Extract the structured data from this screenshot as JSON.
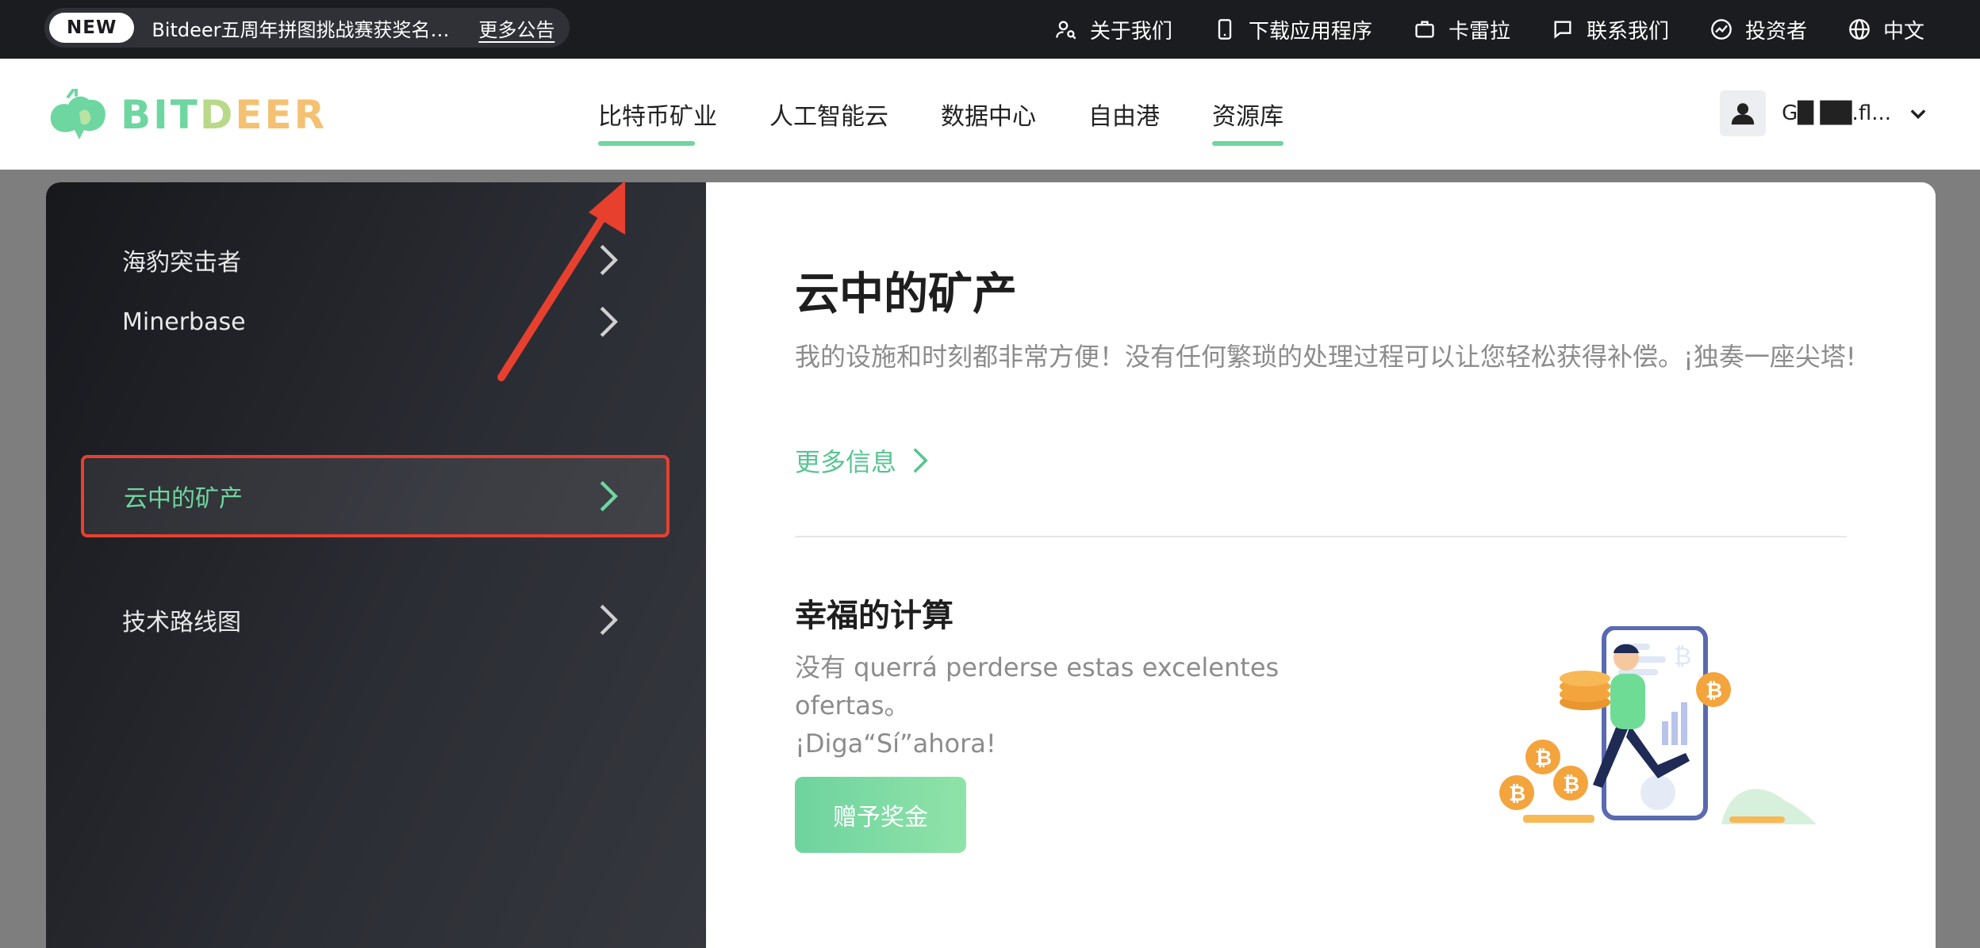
{
  "topbar": {
    "badge": "NEW",
    "announcement": "Bitdeer五周年拼图挑战赛获奖名单公布",
    "more_announcements": "更多公告",
    "links": [
      {
        "label": "关于我们",
        "icon": "user-search-icon"
      },
      {
        "label": "下载应用程序",
        "icon": "phone-icon"
      },
      {
        "label": "卡雷拉",
        "icon": "briefcase-icon"
      },
      {
        "label": "联系我们",
        "icon": "chat-icon"
      },
      {
        "label": "投资者",
        "icon": "chart-circle-icon"
      },
      {
        "label": "中文",
        "icon": "globe-icon"
      }
    ]
  },
  "nav": {
    "logo_text": "BITDEER",
    "items": [
      {
        "label": "比特币矿业",
        "active": true
      },
      {
        "label": "人工智能云",
        "active": false
      },
      {
        "label": "数据中心",
        "active": false
      },
      {
        "label": "自由港",
        "active": false
      },
      {
        "label": "资源库",
        "active": true
      }
    ],
    "user_name": "G█  ██.fl..."
  },
  "sidebar": {
    "items": [
      {
        "label": "海豹突击者",
        "active": false
      },
      {
        "label": "Minerbase",
        "active": false
      },
      {
        "label": "云中的矿产",
        "active": true
      },
      {
        "label": "技术路线图",
        "active": false
      }
    ]
  },
  "content": {
    "title": "云中的矿产",
    "description": "我的设施和时刻都非常方便！没有任何繁琐的处理过程可以让您轻松获得补偿。¡独奏一座尖塔!",
    "more_link": "更多信息",
    "section2_title": "幸福的计算",
    "section2_line1": "没有 querrá perderse estas excelentes ofertas。",
    "section2_line2": "¡Diga“Sí”ahora!",
    "cta_label": "赠予奖金"
  },
  "colors": {
    "accent_green": "#6ed6a0",
    "annotation_red": "#e8402f",
    "topbar_bg": "#1b1c20"
  }
}
